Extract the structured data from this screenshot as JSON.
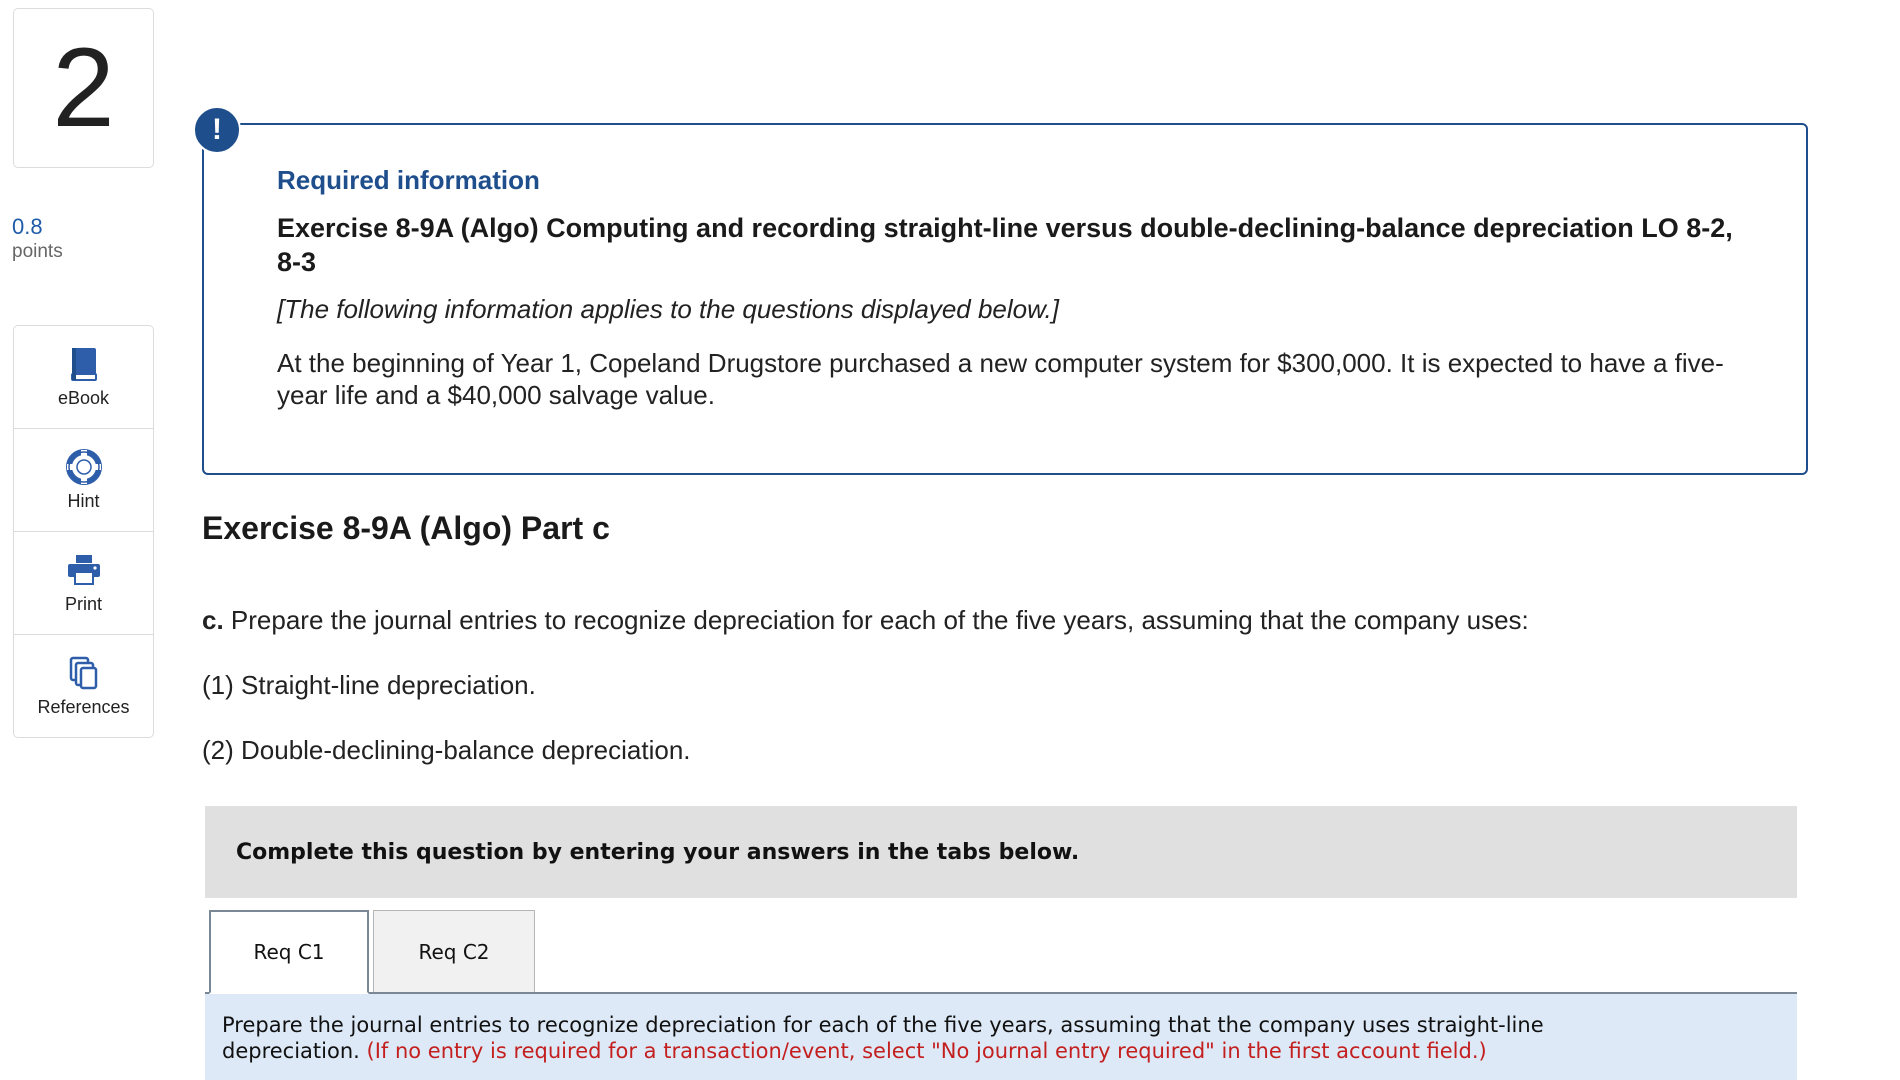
{
  "question": {
    "number": "2",
    "points_value": "0.8",
    "points_label": "points"
  },
  "tools": [
    {
      "label": "eBook",
      "icon": "book-icon"
    },
    {
      "label": "Hint",
      "icon": "lifebuoy-icon"
    },
    {
      "label": "Print",
      "icon": "printer-icon"
    },
    {
      "label": "References",
      "icon": "copy-documents-icon"
    }
  ],
  "required_info": {
    "badge": "!",
    "heading": "Required information",
    "exercise_title": "Exercise 8-9A (Algo) Computing and recording straight-line versus double-declining-balance depreciation LO 8-2, 8-3",
    "note": "[The following information applies to the questions displayed below.]",
    "body": "At the beginning of Year 1, Copeland Drugstore purchased a new computer system for $300,000. It is expected to have a five-year life and a $40,000 salvage value."
  },
  "part": {
    "title": "Exercise 8-9A (Algo) Part c",
    "prompt_label": "c.",
    "prompt_text": "Prepare the journal entries to recognize depreciation for each of the five years, assuming that the company uses:",
    "option_1": "(1) Straight-line depreciation.",
    "option_2": "(2) Double-declining-balance depreciation."
  },
  "instructions": "Complete this question by entering your answers in the tabs below.",
  "tabs": [
    {
      "label": "Req C1",
      "active": true
    },
    {
      "label": "Req C2",
      "active": false
    }
  ],
  "panel": {
    "text": "Prepare the journal entries to recognize depreciation for each of the five years, assuming that the company uses straight-line depreciation.",
    "note": "(If no entry is required for a transaction/event, select \"No journal entry required\" in the first account field.)"
  },
  "colors": {
    "accent_blue": "#1f4e8c",
    "points_blue": "#1f5ba8",
    "note_red": "#c41f1f",
    "panel_bg": "#dde9f6",
    "instr_bg": "#e0e0e0"
  }
}
